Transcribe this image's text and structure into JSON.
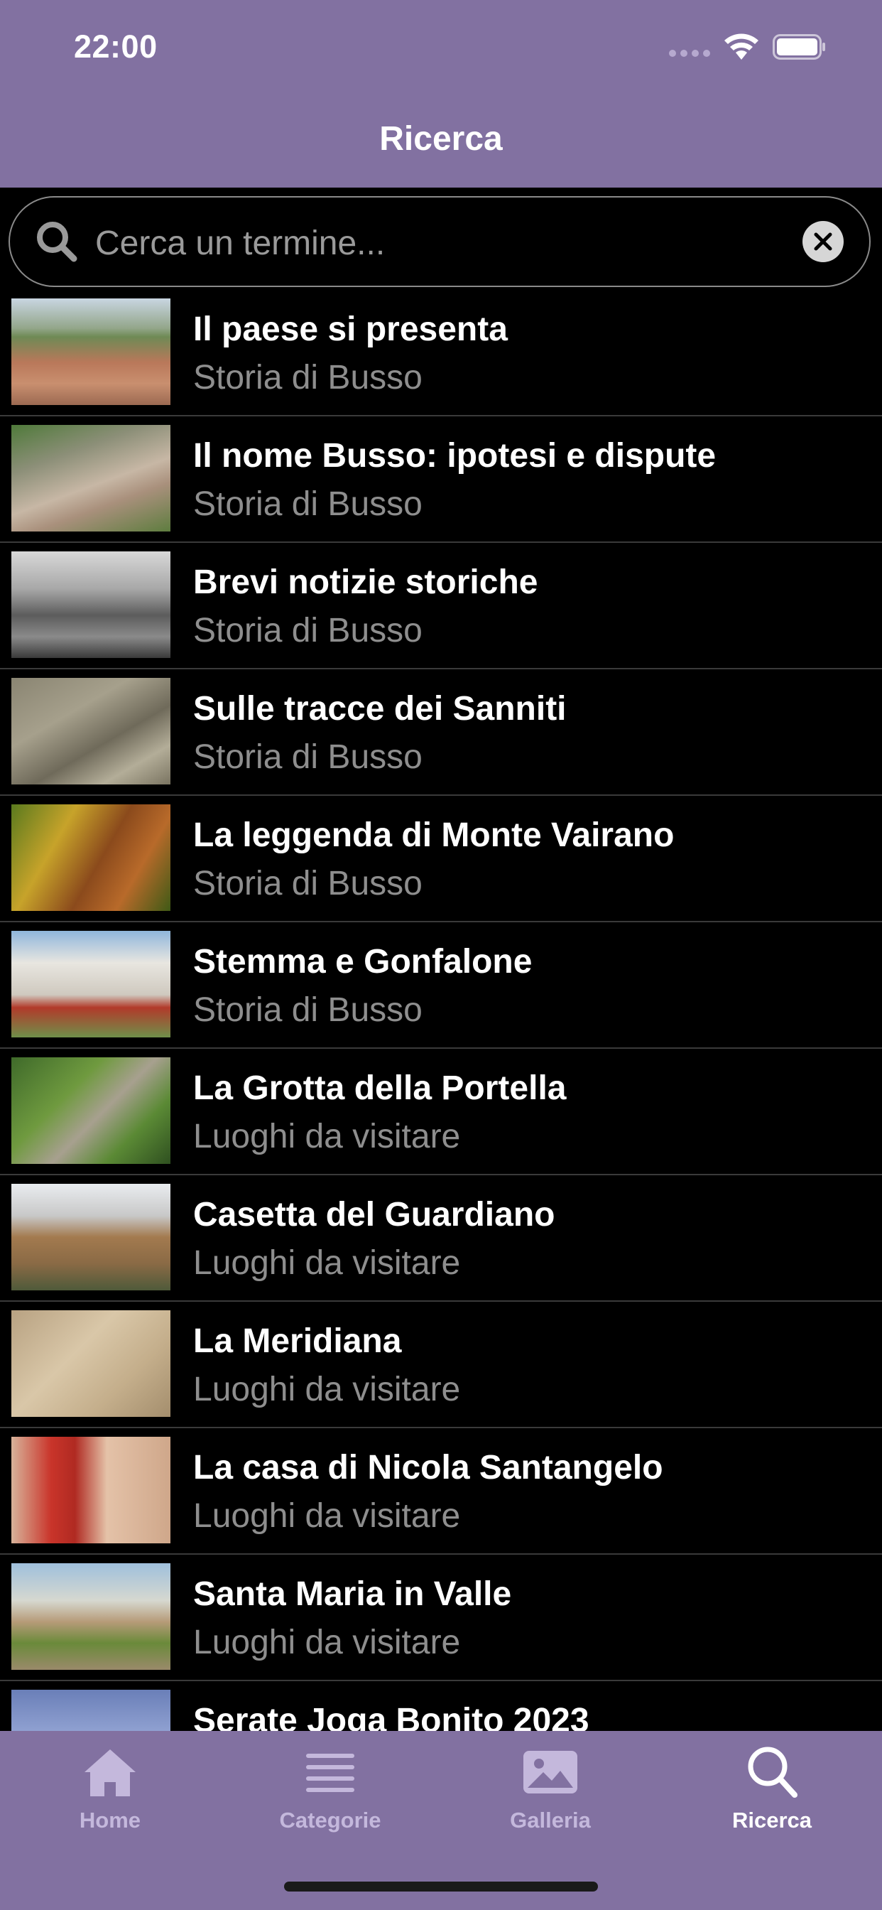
{
  "status_bar": {
    "time": "22:00"
  },
  "nav": {
    "title": "Ricerca"
  },
  "search": {
    "placeholder": "Cerca un termine...",
    "value": ""
  },
  "results": [
    {
      "title": "Il paese si presenta",
      "category": "Storia di Busso",
      "thumb": "aerial-town"
    },
    {
      "title": "Il nome Busso: ipotesi e dispute",
      "category": "Storia di Busso",
      "thumb": "aerial-town-2"
    },
    {
      "title": "Brevi notizie storiche",
      "category": "Storia di Busso",
      "thumb": "bw-photo"
    },
    {
      "title": "Sulle tracce dei Sanniti",
      "category": "Storia di Busso",
      "thumb": "excavation"
    },
    {
      "title": "La leggenda di Monte Vairano",
      "category": "Storia di Busso",
      "thumb": "autumn-forest"
    },
    {
      "title": "Stemma e Gonfalone",
      "category": "Storia di Busso",
      "thumb": "town-hall"
    },
    {
      "title": "La Grotta della Portella",
      "category": "Luoghi da visitare",
      "thumb": "grotto"
    },
    {
      "title": "Casetta del Guardiano",
      "category": "Luoghi da visitare",
      "thumb": "stone-house"
    },
    {
      "title": "La Meridiana",
      "category": "Luoghi da visitare",
      "thumb": "sundial"
    },
    {
      "title": "La casa di Nicola Santangelo",
      "category": "Luoghi da visitare",
      "thumb": "red-door"
    },
    {
      "title": "Santa Maria in Valle",
      "category": "Luoghi da visitare",
      "thumb": "chapel"
    },
    {
      "title": "Serate Joga Bonito 2023",
      "category": "",
      "thumb": "event-poster"
    }
  ],
  "tabs": [
    {
      "label": "Home",
      "icon": "house-icon"
    },
    {
      "label": "Categorie",
      "icon": "list-icon"
    },
    {
      "label": "Galleria",
      "icon": "photo-icon"
    },
    {
      "label": "Ricerca",
      "icon": "search-icon"
    }
  ],
  "colors": {
    "accent": "#8271a1",
    "tab_inactive": "#c4b8dc",
    "subtitle": "#8e8e8e"
  }
}
